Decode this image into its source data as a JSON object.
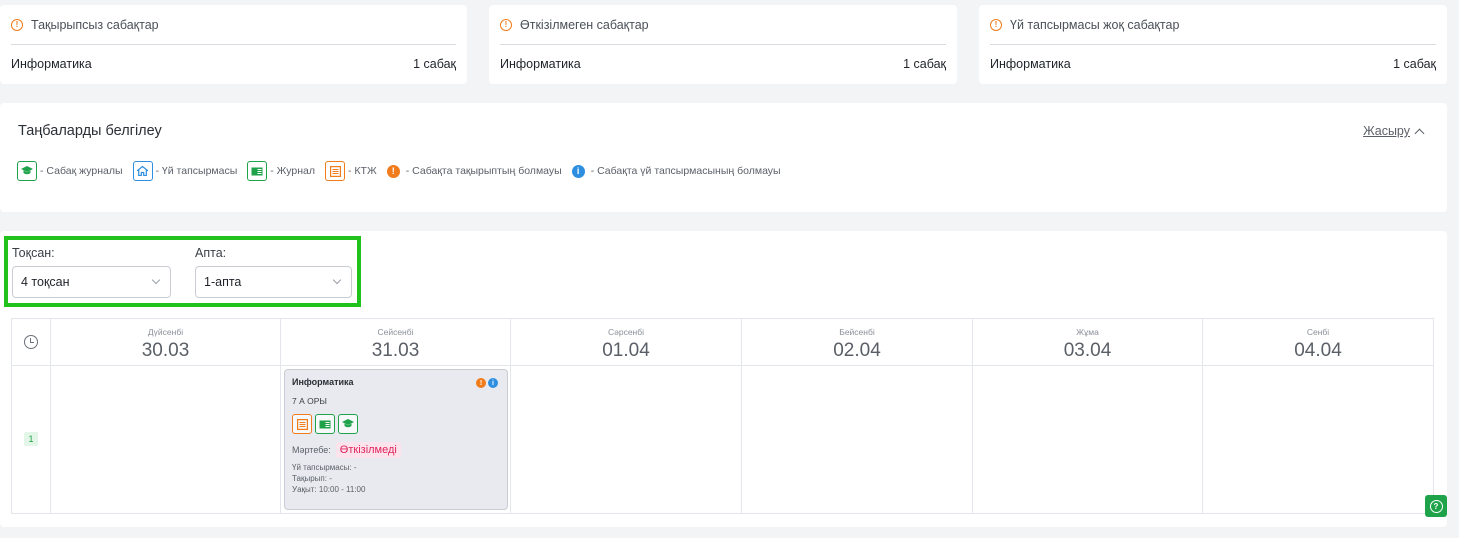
{
  "stats": [
    {
      "title": "Тақырыпсыз сабақтар",
      "subject": "Информатика",
      "count": "1 сабақ",
      "icon": "warning-circle-icon"
    },
    {
      "title": "Өткізілмеген сабақтар",
      "subject": "Информатика",
      "count": "1 сабақ",
      "icon": "warning-circle-icon"
    },
    {
      "title": "Үй тапсырмасы жоқ сабақтар",
      "subject": "Информатика",
      "count": "1 сабақ",
      "icon": "warning-circle-icon"
    }
  ],
  "legend": {
    "title": "Таңбаларды белгілеу",
    "hide_label": "Жасыру",
    "items": [
      {
        "label": "- Сабақ журналы",
        "icon": "graduation-cap-icon"
      },
      {
        "label": "- Үй тапсырмасы",
        "icon": "home-icon"
      },
      {
        "label": "- Журнал",
        "icon": "book-icon"
      },
      {
        "label": "- КТЖ",
        "icon": "list-icon"
      },
      {
        "label": "- Сабақта тақырыптың болмауы",
        "icon": "orange-info-dot"
      },
      {
        "label": "- Сабақта үй тапсырмасының болмауы",
        "icon": "blue-info-dot"
      }
    ]
  },
  "filters": {
    "quarter_label": "Тоқсан:",
    "quarter_value": "4 тоқсан",
    "week_label": "Апта:",
    "week_value": "1-апта"
  },
  "days": [
    {
      "name": "Дүйсенбі",
      "date": "30.03"
    },
    {
      "name": "Сейсенбі",
      "date": "31.03"
    },
    {
      "name": "Сәрсенбі",
      "date": "01.04"
    },
    {
      "name": "Бейсенбі",
      "date": "02.04"
    },
    {
      "name": "Жұма",
      "date": "03.04"
    },
    {
      "name": "Сенбі",
      "date": "04.04"
    }
  ],
  "period_number": "1",
  "lesson": {
    "title": "Информатика",
    "class_name": "7 А ОРЫ",
    "status_label": "Мәртебе:",
    "status_value": "Өткізілмеді",
    "homework": "Үй тапсырмасы: -",
    "topic": "Тақырып: -",
    "time": "Уақыт: 10:00 - 11:00"
  },
  "colors": {
    "green": "#1fa34a",
    "orange": "#f07c1b",
    "blue": "#2e8fe0",
    "highlight": "#22c21d",
    "status_pink": "#e0245e"
  }
}
